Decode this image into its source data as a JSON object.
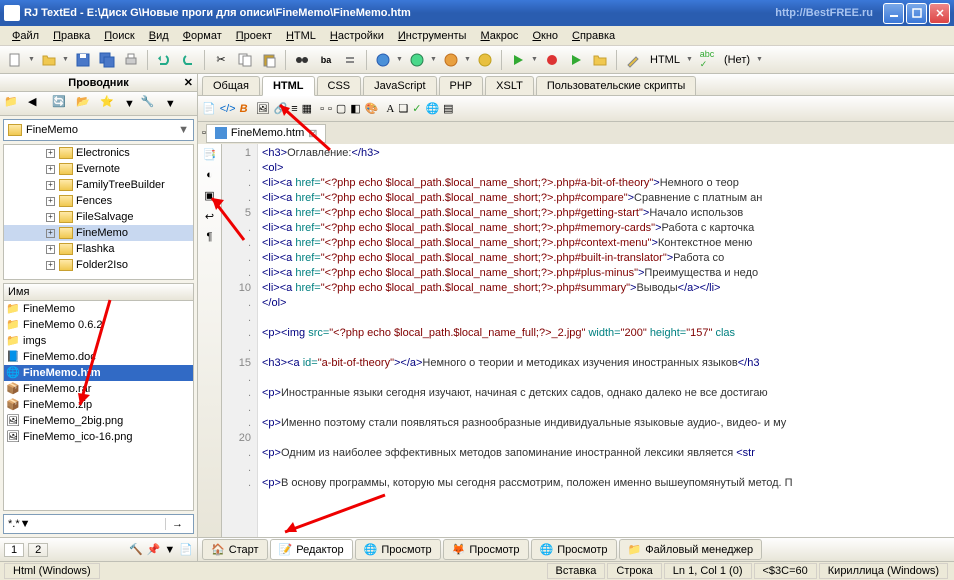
{
  "title": "RJ TextEd - E:\\Диск G\\Новые проги для описи\\FineMemo\\FineMemo.htm",
  "watermark": "http://BestFREE.ru",
  "menu": [
    "Файл",
    "Правка",
    "Поиск",
    "Вид",
    "Формат",
    "Проект",
    "HTML",
    "Настройки",
    "Инструменты",
    "Макрос",
    "Окно",
    "Справка"
  ],
  "toolbar_html_label": "HTML",
  "toolbar_none_label": "(Нет)",
  "sidebar": {
    "title": "Проводник",
    "path": "FineMemo",
    "tree": [
      "Electronics",
      "Evernote",
      "FamilyTreeBuilder",
      "Fences",
      "FileSalvage",
      "FineMemo",
      "Flashka",
      "Folder2Iso"
    ],
    "tree_selected_index": 5,
    "list_header": "Имя",
    "files": [
      "FineMemo",
      "FineMemo 0.6.2",
      "imgs",
      "FineMemo.doc",
      "FineMemo.htm",
      "FineMemo.rar",
      "FineMemo.zip",
      "FineMemo_2big.png",
      "FineMemo_ico-16.png"
    ],
    "file_selected_index": 4,
    "filter": "*.*",
    "bottom_tabs": [
      "1",
      "2"
    ]
  },
  "lang_tabs": [
    "Общая",
    "HTML",
    "CSS",
    "JavaScript",
    "PHP",
    "XSLT",
    "Пользовательские скрипты"
  ],
  "lang_tab_active": 1,
  "doc_tab": "FineMemo.htm",
  "gutter_lines": [
    "1",
    ".",
    ".",
    ".",
    "5",
    ".",
    ".",
    ".",
    ".",
    "10",
    ".",
    ".",
    ".",
    ".",
    "15",
    ".",
    ".",
    ".",
    ".",
    "20",
    ".",
    ".",
    "."
  ],
  "footer_tabs": [
    "Старт",
    "Редактор",
    "Просмотр",
    "Просмотр",
    "Просмотр",
    "Файловый менеджер"
  ],
  "footer_tab_active": 1,
  "status": {
    "enc_left": "Html (Windows)",
    "insert": "Вставка",
    "line": "Строка",
    "pos": "Ln 1, Col 1 (0)",
    "sel": "<$3C=60",
    "enc": "Кириллица (Windows)"
  },
  "code_lines_html": [
    "<span class='tag'>&lt;h3&gt;</span><span class='txt'>Оглавление:</span><span class='tag'>&lt;/h3&gt;</span>",
    "<span class='tag'>&lt;ol&gt;</span>",
    "<span class='tag'>&lt;li&gt;&lt;a</span> <span class='attr'>href=</span><span class='str'>\"&lt;?php echo $local_path.$local_name_short;?&gt;.php#a-bit-of-theory\"</span><span class='tag'>&gt;</span><span class='txt'>Немного о теор</span>",
    "<span class='tag'>&lt;li&gt;&lt;a</span> <span class='attr'>href=</span><span class='str'>\"&lt;?php echo $local_path.$local_name_short;?&gt;.php#compare\"</span><span class='tag'>&gt;</span><span class='txt'>Сравнение с платным ан</span>",
    "<span class='tag'>&lt;li&gt;&lt;a</span> <span class='attr'>href=</span><span class='str'>\"&lt;?php echo $local_path.$local_name_short;?&gt;.php#getting-start\"</span><span class='tag'>&gt;</span><span class='txt'>Начало использов</span>",
    "<span class='tag'>&lt;li&gt;&lt;a</span> <span class='attr'>href=</span><span class='str'>\"&lt;?php echo $local_path.$local_name_short;?&gt;.php#memory-cards\"</span><span class='tag'>&gt;</span><span class='txt'>Работа с карточка</span>",
    "<span class='tag'>&lt;li&gt;&lt;a</span> <span class='attr'>href=</span><span class='str'>\"&lt;?php echo $local_path.$local_name_short;?&gt;.php#context-menu\"</span><span class='tag'>&gt;</span><span class='txt'>Контекстное меню</span>",
    "<span class='tag'>&lt;li&gt;&lt;a</span> <span class='attr'>href=</span><span class='str'>\"&lt;?php echo $local_path.$local_name_short;?&gt;.php#built-in-translator\"</span><span class='tag'>&gt;</span><span class='txt'>Работа со</span>",
    "<span class='tag'>&lt;li&gt;&lt;a</span> <span class='attr'>href=</span><span class='str'>\"&lt;?php echo $local_path.$local_name_short;?&gt;.php#plus-minus\"</span><span class='tag'>&gt;</span><span class='txt'>Преимущества и недо</span>",
    "<span class='tag'>&lt;li&gt;&lt;a</span> <span class='attr'>href=</span><span class='str'>\"&lt;?php echo $local_path.$local_name_short;?&gt;.php#summary\"</span><span class='tag'>&gt;</span><span class='txt'>Выводы</span><span class='tag'>&lt;/a&gt;&lt;/li&gt;</span>",
    "<span class='tag'>&lt;/ol&gt;</span>",
    "",
    "<span class='tag'>&lt;p&gt;&lt;img</span> <span class='attr'>src=</span><span class='str'>\"&lt;?php echo $local_path.$local_name_full;?&gt;_2.jpg\"</span> <span class='attr'>width=</span><span class='str'>\"200\"</span> <span class='attr'>height=</span><span class='str'>\"157\"</span> <span class='attr'>clas</span>",
    "",
    "<span class='tag'>&lt;h3&gt;&lt;a</span> <span class='attr'>id=</span><span class='str'>\"a-bit-of-theory\"</span><span class='tag'>&gt;&lt;/a&gt;</span><span class='txt'>Немного о теории и методиках изучения иностранных языков</span><span class='tag'>&lt;/h3</span>",
    "",
    "<span class='tag'>&lt;p&gt;</span><span class='txt'>Иностранные языки сегодня изучают, начиная с детских садов, однако далеко не все достигаю</span>",
    "",
    "<span class='tag'>&lt;p&gt;</span><span class='txt'>Именно поэтому стали появляться разнообразные индивидуальные языковые аудио-, видео- и му</span>",
    "",
    "<span class='tag'>&lt;p&gt;</span><span class='txt'>Одним из наиболее эффективных методов запоминание иностранной лексики является </span><span class='tag'>&lt;str</span>",
    "",
    "<span class='tag'>&lt;p&gt;</span><span class='txt'>В основу программы, которую мы сегодня рассмотрим, положен именно вышеупомянутый метод. П</span>"
  ]
}
